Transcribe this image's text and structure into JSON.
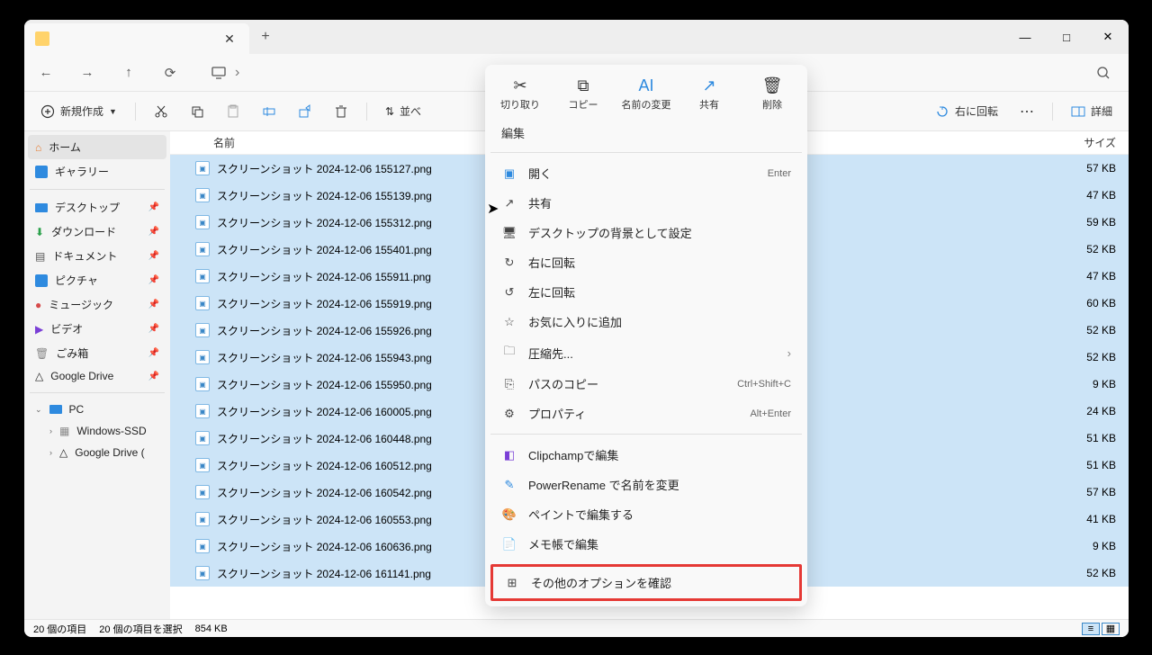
{
  "window": {
    "minimize": "—",
    "maximize": "□",
    "close": "✕"
  },
  "tab": {
    "title": "",
    "close": "✕",
    "new": "+"
  },
  "nav": {
    "back": "←",
    "forward": "→",
    "up": "↑",
    "refresh": "⟳",
    "chevron": "›"
  },
  "toolbar": {
    "new": "新規作成",
    "sort": "並べ",
    "rotate_right": "右に回転",
    "more": "⋯",
    "details": "詳細"
  },
  "sidebar": {
    "home": "ホーム",
    "gallery": "ギャラリー",
    "desktop": "デスクトップ",
    "downloads": "ダウンロード",
    "documents": "ドキュメント",
    "pictures": "ピクチャ",
    "music": "ミュージック",
    "videos": "ビデオ",
    "trash": "ごみ箱",
    "gdrive": "Google Drive",
    "pc": "PC",
    "winssd": "Windows-SSD",
    "gdrive2": "Google Drive ("
  },
  "columns": {
    "name": "名前",
    "size": "サイズ"
  },
  "files": [
    {
      "name": "スクリーンショット 2024-12-06 155127.png",
      "size": "57 KB"
    },
    {
      "name": "スクリーンショット 2024-12-06 155139.png",
      "size": "47 KB"
    },
    {
      "name": "スクリーンショット 2024-12-06 155312.png",
      "size": "59 KB"
    },
    {
      "name": "スクリーンショット 2024-12-06 155401.png",
      "size": "52 KB"
    },
    {
      "name": "スクリーンショット 2024-12-06 155911.png",
      "size": "47 KB"
    },
    {
      "name": "スクリーンショット 2024-12-06 155919.png",
      "size": "60 KB"
    },
    {
      "name": "スクリーンショット 2024-12-06 155926.png",
      "size": "52 KB"
    },
    {
      "name": "スクリーンショット 2024-12-06 155943.png",
      "size": "52 KB"
    },
    {
      "name": "スクリーンショット 2024-12-06 155950.png",
      "size": "9 KB"
    },
    {
      "name": "スクリーンショット 2024-12-06 160005.png",
      "size": "24 KB"
    },
    {
      "name": "スクリーンショット 2024-12-06 160448.png",
      "size": "51 KB"
    },
    {
      "name": "スクリーンショット 2024-12-06 160512.png",
      "size": "51 KB"
    },
    {
      "name": "スクリーンショット 2024-12-06 160542.png",
      "size": "57 KB"
    },
    {
      "name": "スクリーンショット 2024-12-06 160553.png",
      "size": "41 KB"
    },
    {
      "name": "スクリーンショット 2024-12-06 160636.png",
      "size": "9 KB"
    },
    {
      "name": "スクリーンショット 2024-12-06 161141.png",
      "size": "52 KB"
    }
  ],
  "status": {
    "count": "20 個の項目",
    "selected": "20 個の項目を選択",
    "size": "854 KB"
  },
  "ctx": {
    "top": {
      "cut": "切り取り",
      "copy": "コピー",
      "rename": "名前の変更",
      "share": "共有",
      "delete": "削除"
    },
    "edit": "編集",
    "open": "開く",
    "open_sc": "Enter",
    "share2": "共有",
    "wallpaper": "デスクトップの背景として設定",
    "rr": "右に回転",
    "rl": "左に回転",
    "fav": "お気に入りに追加",
    "compress": "圧縮先...",
    "copypath": "パスのコピー",
    "copypath_sc": "Ctrl+Shift+C",
    "props": "プロパティ",
    "props_sc": "Alt+Enter",
    "clipchamp": "Clipchampで編集",
    "powerrename": "PowerRename で名前を変更",
    "paint": "ペイントで編集する",
    "notepad": "メモ帳で編集",
    "more": "その他のオプションを確認"
  }
}
